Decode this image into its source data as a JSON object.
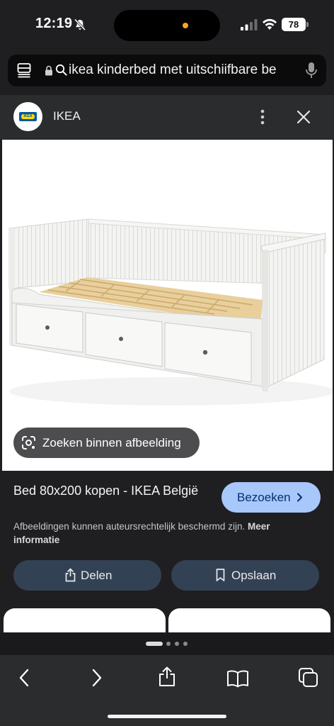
{
  "status_bar": {
    "time": "12:19",
    "battery": "78",
    "island_dot_color": "#f5a623",
    "icons": [
      "bell-slash-icon",
      "cellular-signal-icon",
      "wifi-icon",
      "battery-icon"
    ]
  },
  "address_bar": {
    "text": "ikea kinderbed met uitschiifbare be",
    "icons": [
      "reader-menu-icon",
      "lock-icon",
      "search-icon",
      "microphone-icon"
    ]
  },
  "page_header": {
    "site_name": "IKEA",
    "logo_text": "IKEA",
    "icons": [
      "more-vertical-icon",
      "close-icon"
    ]
  },
  "image": {
    "lens_label": "Zoeken binnen afbeelding"
  },
  "result": {
    "title": "Bed 80x200 kopen - IKEA België",
    "visit_label": "Bezoeken",
    "copyright_text": "Afbeeldingen kunnen auteursrechtelijk beschermd zijn.",
    "copyright_more": "Meer informatie",
    "share_label": "Delen",
    "save_label": "Opslaan"
  },
  "carousel": {
    "active_index": 0,
    "total": 4
  },
  "toolbar": {
    "icons": [
      "back-icon",
      "forward-icon",
      "share-icon",
      "bookmarks-icon",
      "tabs-icon"
    ]
  },
  "colors": {
    "background": "#1f1f21",
    "accent": "#a8c7fa",
    "action_button": "#334154"
  }
}
